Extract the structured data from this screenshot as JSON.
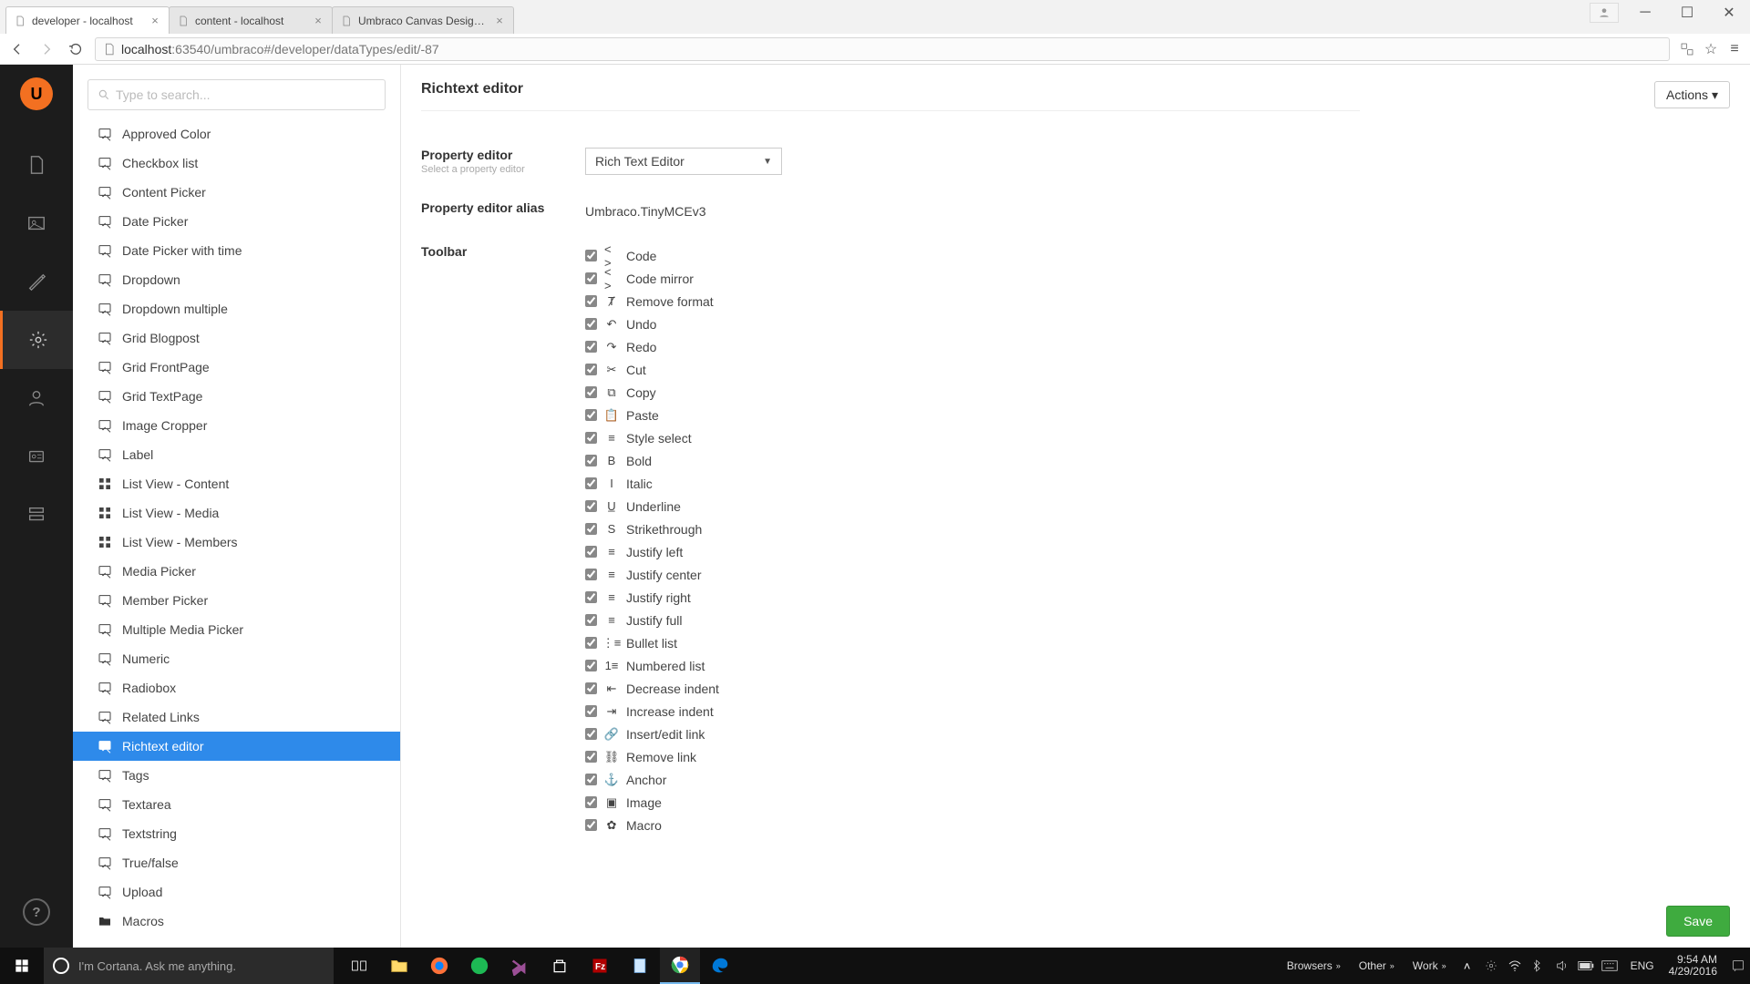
{
  "browser": {
    "tabs": [
      {
        "title": "developer - localhost",
        "active": true
      },
      {
        "title": "content - localhost",
        "active": false
      },
      {
        "title": "Umbraco Canvas Designer",
        "active": false
      }
    ],
    "url_host": "localhost",
    "url_port": ":63540",
    "url_path": "/umbraco#/developer/dataTypes/edit/-87"
  },
  "rail": {
    "items": [
      "content-icon",
      "media-icon",
      "settings-icon",
      "developer-icon",
      "users-icon",
      "members-icon",
      "forms-icon"
    ],
    "active_index": 3
  },
  "search": {
    "placeholder": "Type to search..."
  },
  "tree": {
    "items": [
      {
        "label": "Approved Color",
        "icon": "autofill",
        "selected": false
      },
      {
        "label": "Checkbox list",
        "icon": "autofill",
        "selected": false
      },
      {
        "label": "Content Picker",
        "icon": "autofill",
        "selected": false
      },
      {
        "label": "Date Picker",
        "icon": "autofill",
        "selected": false
      },
      {
        "label": "Date Picker with time",
        "icon": "autofill",
        "selected": false
      },
      {
        "label": "Dropdown",
        "icon": "autofill",
        "selected": false
      },
      {
        "label": "Dropdown multiple",
        "icon": "autofill",
        "selected": false
      },
      {
        "label": "Grid Blogpost",
        "icon": "autofill",
        "selected": false
      },
      {
        "label": "Grid FrontPage",
        "icon": "autofill",
        "selected": false
      },
      {
        "label": "Grid TextPage",
        "icon": "autofill",
        "selected": false
      },
      {
        "label": "Image Cropper",
        "icon": "autofill",
        "selected": false
      },
      {
        "label": "Label",
        "icon": "autofill",
        "selected": false
      },
      {
        "label": "List View - Content",
        "icon": "thumbnails",
        "selected": false
      },
      {
        "label": "List View - Media",
        "icon": "thumbnails",
        "selected": false
      },
      {
        "label": "List View - Members",
        "icon": "thumbnails",
        "selected": false
      },
      {
        "label": "Media Picker",
        "icon": "autofill",
        "selected": false
      },
      {
        "label": "Member Picker",
        "icon": "autofill",
        "selected": false
      },
      {
        "label": "Multiple Media Picker",
        "icon": "autofill",
        "selected": false
      },
      {
        "label": "Numeric",
        "icon": "autofill",
        "selected": false
      },
      {
        "label": "Radiobox",
        "icon": "autofill",
        "selected": false
      },
      {
        "label": "Related Links",
        "icon": "autofill",
        "selected": false
      },
      {
        "label": "Richtext editor",
        "icon": "autofill",
        "selected": true
      },
      {
        "label": "Tags",
        "icon": "autofill",
        "selected": false
      },
      {
        "label": "Textarea",
        "icon": "autofill",
        "selected": false
      },
      {
        "label": "Textstring",
        "icon": "autofill",
        "selected": false
      },
      {
        "label": "True/false",
        "icon": "autofill",
        "selected": false
      },
      {
        "label": "Upload",
        "icon": "autofill",
        "selected": false
      },
      {
        "label": "Macros",
        "icon": "folder",
        "selected": false
      }
    ]
  },
  "page": {
    "title": "Richtext editor",
    "actions_label": "Actions",
    "save_label": "Save",
    "property_editor": {
      "label": "Property editor",
      "hint": "Select a property editor",
      "value": "Rich Text Editor"
    },
    "alias": {
      "label": "Property editor alias",
      "value": "Umbraco.TinyMCEv3"
    },
    "toolbar_label": "Toolbar",
    "toolbar": [
      {
        "label": "Code",
        "glyph": "< >",
        "checked": true
      },
      {
        "label": "Code mirror",
        "glyph": "< >",
        "checked": true
      },
      {
        "label": "Remove format",
        "glyph": "Ⱦ",
        "checked": true
      },
      {
        "label": "Undo",
        "glyph": "↶",
        "checked": true
      },
      {
        "label": "Redo",
        "glyph": "↷",
        "checked": true
      },
      {
        "label": "Cut",
        "glyph": "✂",
        "checked": true
      },
      {
        "label": "Copy",
        "glyph": "⧉",
        "checked": true
      },
      {
        "label": "Paste",
        "glyph": "📋",
        "checked": true
      },
      {
        "label": "Style select",
        "glyph": "≡",
        "checked": true
      },
      {
        "label": "Bold",
        "glyph": "B",
        "checked": true
      },
      {
        "label": "Italic",
        "glyph": "I",
        "checked": true
      },
      {
        "label": "Underline",
        "glyph": "U̲",
        "checked": true
      },
      {
        "label": "Strikethrough",
        "glyph": "S",
        "checked": true
      },
      {
        "label": "Justify left",
        "glyph": "≡",
        "checked": true
      },
      {
        "label": "Justify center",
        "glyph": "≡",
        "checked": true
      },
      {
        "label": "Justify right",
        "glyph": "≡",
        "checked": true
      },
      {
        "label": "Justify full",
        "glyph": "≡",
        "checked": true
      },
      {
        "label": "Bullet list",
        "glyph": "⋮≡",
        "checked": true
      },
      {
        "label": "Numbered list",
        "glyph": "1≡",
        "checked": true
      },
      {
        "label": "Decrease indent",
        "glyph": "⇤",
        "checked": true
      },
      {
        "label": "Increase indent",
        "glyph": "⇥",
        "checked": true
      },
      {
        "label": "Insert/edit link",
        "glyph": "🔗",
        "checked": true
      },
      {
        "label": "Remove link",
        "glyph": "⛓",
        "checked": true
      },
      {
        "label": "Anchor",
        "glyph": "⚓",
        "checked": true
      },
      {
        "label": "Image",
        "glyph": "▣",
        "checked": true
      },
      {
        "label": "Macro",
        "glyph": "✿",
        "checked": true
      }
    ]
  },
  "taskbar": {
    "cortana_placeholder": "I'm Cortana. Ask me anything.",
    "tray_texts": [
      "Browsers",
      "Other",
      "Work"
    ],
    "lang": "ENG",
    "time": "9:54 AM",
    "date": "4/29/2016"
  }
}
